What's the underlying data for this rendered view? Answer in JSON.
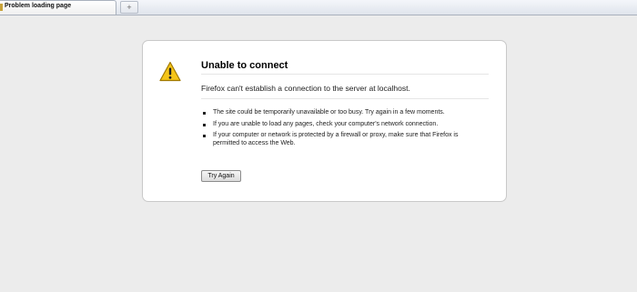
{
  "tabs": [
    {
      "label": "Problem loading page"
    }
  ],
  "new_tab": {
    "label": "+"
  },
  "error": {
    "title": "Unable to connect",
    "description": "Firefox can't establish a connection to the server at localhost.",
    "bullets": [
      "The site could be temporarily unavailable or too busy. Try again in a few moments.",
      "If you are unable to load any pages, check your computer's network connection.",
      "If your computer or network is protected by a firewall or proxy, make sure that Firefox is permitted to access the Web."
    ],
    "button_label": "Try Again"
  },
  "icons": {
    "warning": "warning-icon",
    "tab_favicon": "warning-favicon-icon",
    "new_tab": "plus-icon"
  },
  "colors": {
    "warning_fill": "#f5c518",
    "warning_border": "#a07800",
    "page_background": "#ececec"
  }
}
